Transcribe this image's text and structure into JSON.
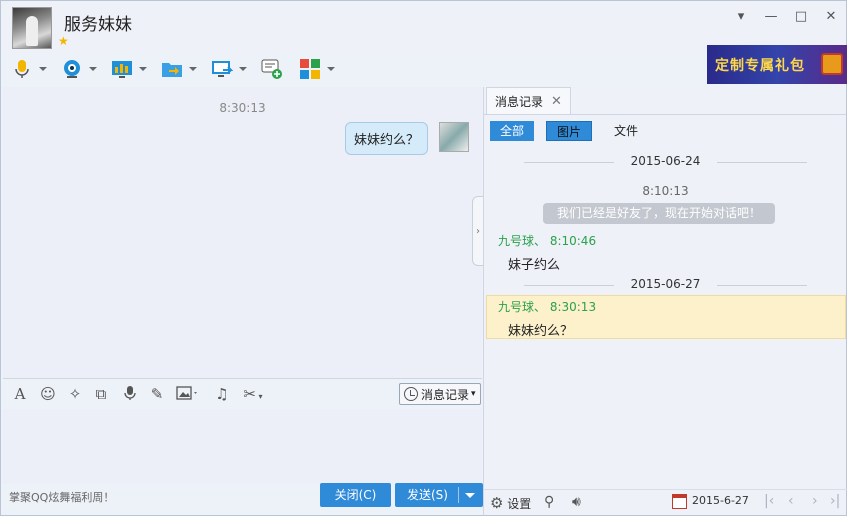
{
  "header": {
    "contact_name": "服务妹妹",
    "window_controls": [
      "chevron-down",
      "minimize",
      "maximize",
      "close"
    ]
  },
  "toolbar": {
    "buttons": [
      "microphone-icon",
      "webcam-icon",
      "screen-share-icon",
      "folder-transfer-icon",
      "remote-desktop-icon",
      "message-add-icon",
      "apps-grid-icon"
    ]
  },
  "ad": {
    "text": "定制专属礼包"
  },
  "chat": {
    "messages": [
      {
        "time": "8:30:13",
        "text": "妹妹约么？"
      }
    ]
  },
  "input_toolbar": {
    "history_label": "消息记录"
  },
  "footer": {
    "promo": "掌聚QQ炫舞福利周！",
    "close_label": "关闭(C)",
    "send_label": "发送(S)"
  },
  "history": {
    "tab_label": "消息记录",
    "filters": [
      "全部",
      "图片",
      "文件"
    ],
    "records": {
      "date1": "2015-06-24",
      "time1": "8:10:13",
      "system_msg": "我们已经是好友了，现在开始对话吧！",
      "head1": "九号球、 8:10:46",
      "body1": "妹子约么",
      "date2": "2015-06-27",
      "head2": "九号球、 8:30:13",
      "body2": "妹妹约么？"
    },
    "bottom": {
      "settings_label": "设置",
      "date": "2015-6-27"
    }
  },
  "colors": {
    "accent": "#2f8ad8",
    "sender_green": "#2aa14a",
    "highlight": "#fdf1cc"
  }
}
